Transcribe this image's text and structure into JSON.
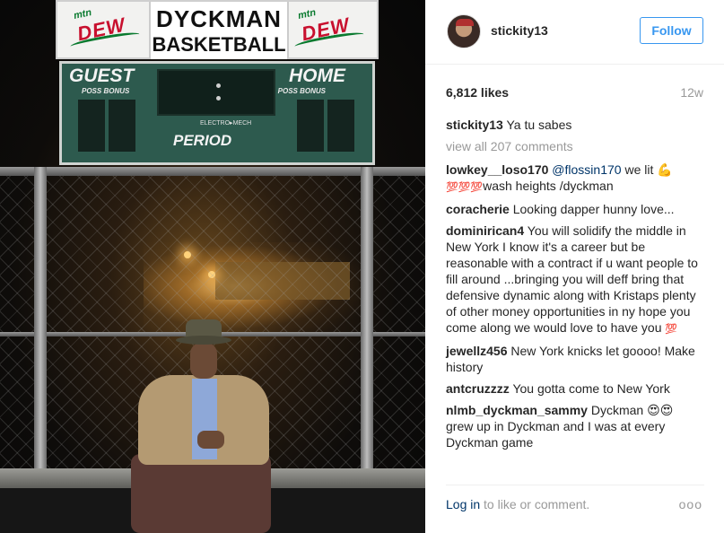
{
  "photo": {
    "board_name_line1": "DYCKMAN",
    "board_name_line2": "BASKETBALL",
    "sponsor_mtn": "mtn",
    "sponsor_dew": "DEW",
    "guest": "GUEST",
    "home": "HOME",
    "poss_bonus": "POSS  BONUS",
    "brand": "ELECTRO▸MECH",
    "period": "PERIOD"
  },
  "post": {
    "username": "stickity13",
    "follow_label": "Follow",
    "likes": "6,812 likes",
    "age": "12w",
    "caption_user": "stickity13",
    "caption_text": "Ya tu sabes",
    "view_all": "view all 207 comments"
  },
  "comments": [
    {
      "user": "lowkey__loso170",
      "mention": "@flossin170",
      "text": " we lit ",
      "emoji_a": "💪",
      "line2_emoji": "💯💯💯",
      "line2_text": "wash heights /dyckman"
    },
    {
      "user": "coracherie",
      "text": "Looking dapper hunny love..."
    },
    {
      "user": "dominirican4",
      "text": "You will solidify the middle in New York I know it's a career but be reasonable with a contract if u want people to fill around ...bringing you will deff bring that defensive dynamic along with Kristaps plenty of other money opportunities in ny hope you come along we would love to have you",
      "emoji": "💯"
    },
    {
      "user": "jewellz456",
      "text": "New York knicks let goooo! Make history"
    },
    {
      "user": "antcruzzzz",
      "text": "You gotta come to New York"
    },
    {
      "user": "nlmb_dyckman_sammy",
      "text": "Dyckman",
      "emoji": "😍😍",
      "text2": "grew up in Dyckman and I was at every Dyckman game"
    }
  ],
  "footer": {
    "login": "Log in",
    "rest": " to like or comment.",
    "more": "ooo"
  },
  "colors": {
    "accent": "#3897f0",
    "link": "#003569",
    "muted": "#999999",
    "scoreboard": "#2d5a4e"
  },
  "icons": {
    "more": "more-options-icon",
    "avatar": "profile-avatar"
  }
}
